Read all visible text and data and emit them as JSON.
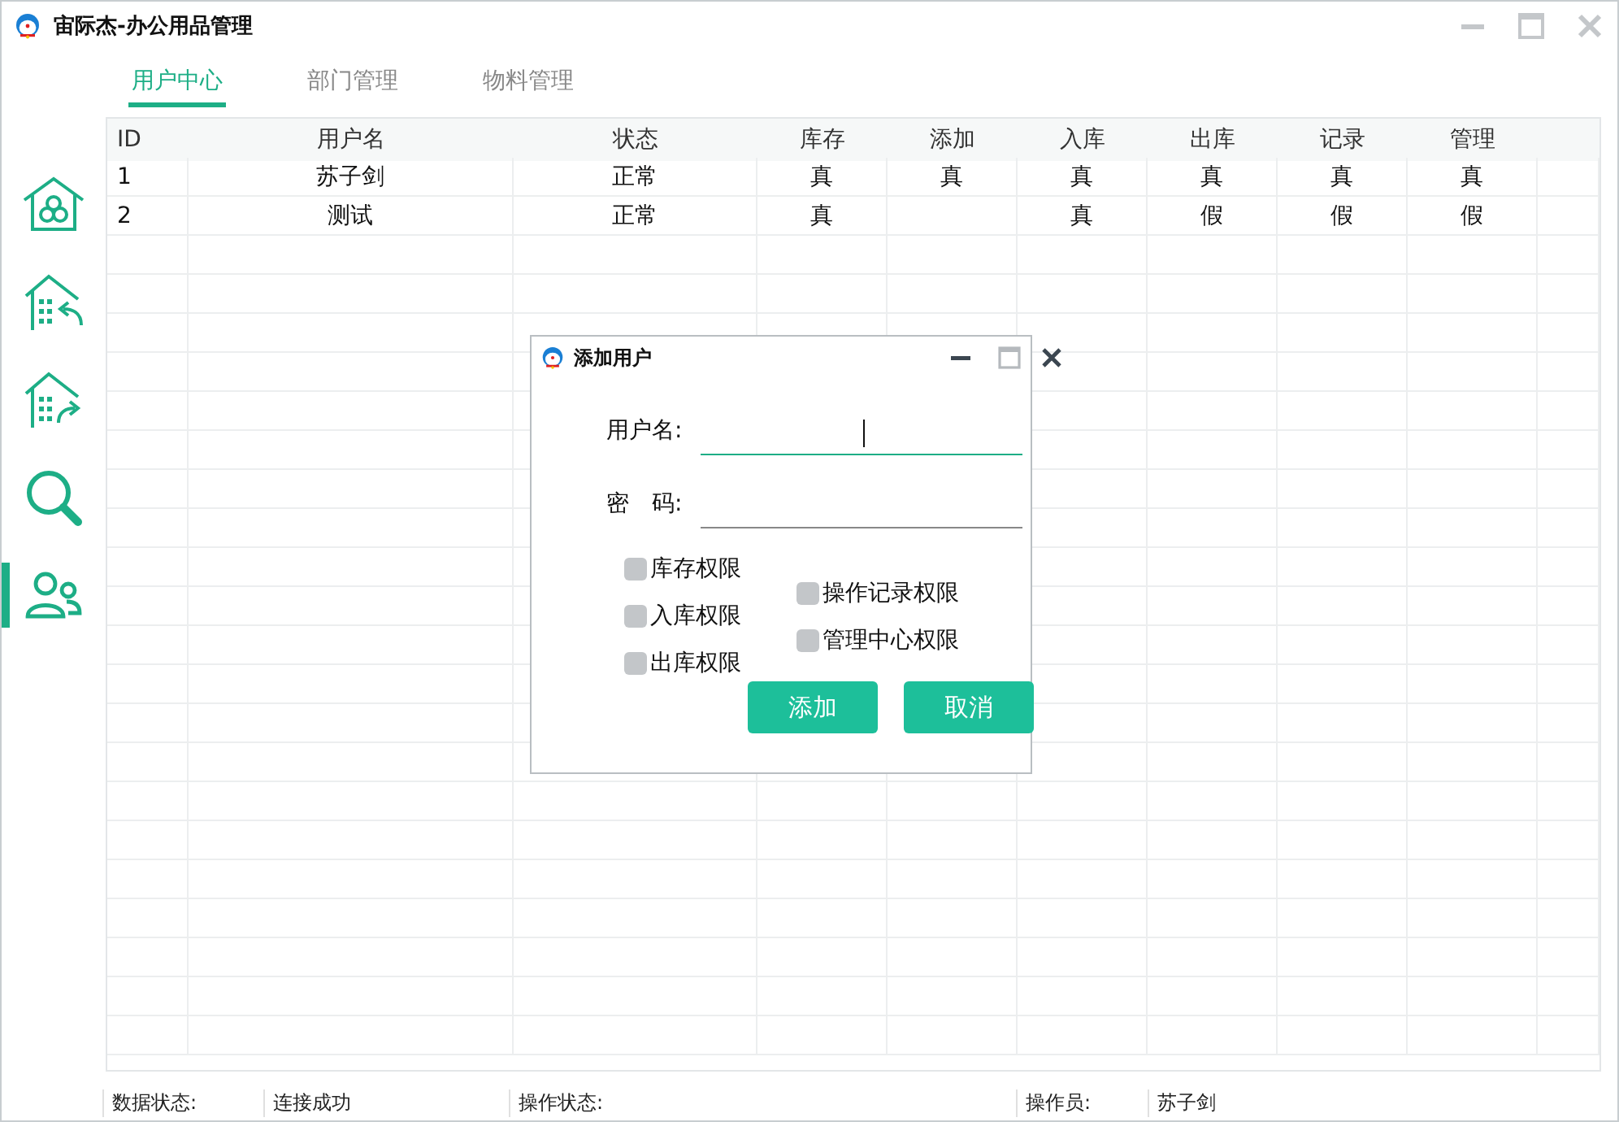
{
  "window": {
    "title": "宙际杰-办公用品管理"
  },
  "tabs": [
    {
      "label": "用户中心",
      "selected": true
    },
    {
      "label": "部门管理",
      "selected": false
    },
    {
      "label": "物料管理",
      "selected": false
    }
  ],
  "sidebar": {
    "items": [
      {
        "selected": false
      },
      {
        "selected": false
      },
      {
        "selected": false
      },
      {
        "selected": false
      },
      {
        "selected": true
      }
    ]
  },
  "table": {
    "columns": [
      "ID",
      "用户名",
      "状态",
      "库存",
      "添加",
      "入库",
      "出库",
      "记录",
      "管理"
    ],
    "rows": [
      [
        "1",
        "苏子剑",
        "正常",
        "真",
        "真",
        "真",
        "真",
        "真",
        "真"
      ],
      [
        "2",
        "测试",
        "正常",
        "真",
        null,
        "真",
        "假",
        "假",
        "假"
      ]
    ]
  },
  "dialog": {
    "title": "添加用户",
    "fields": [
      {
        "label": "用户名:",
        "focused": true
      },
      {
        "label": "密　码:",
        "focused": false
      }
    ],
    "checkbox_columns": [
      [
        {
          "label": "库存权限",
          "checked": false
        },
        {
          "label": "入库权限",
          "checked": false
        },
        {
          "label": "出库权限",
          "checked": false
        }
      ],
      [
        {
          "label": "操作记录权限",
          "checked": false
        },
        {
          "label": "管理中心权限",
          "checked": false
        }
      ]
    ],
    "buttons": [
      "添加",
      "取消"
    ]
  },
  "status_bar": [
    {
      "label": "数据状态:",
      "value": "连接成功"
    },
    {
      "label": "操作状态:"
    },
    {
      "label": "操作员:",
      "value": "苏子剑"
    }
  ]
}
